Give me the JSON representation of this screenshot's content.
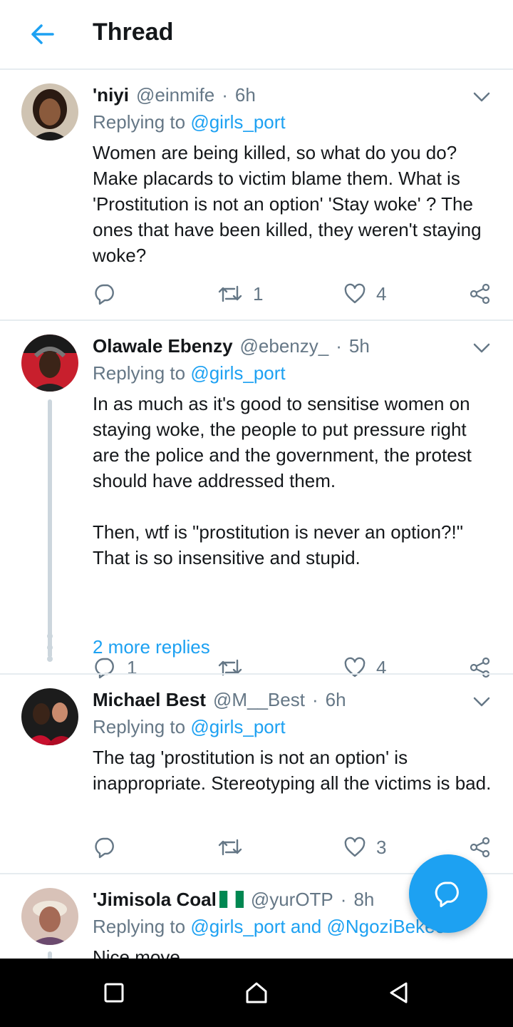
{
  "header": {
    "title": "Thread"
  },
  "tweets": [
    {
      "name": "'niyi",
      "handle": "@einmife",
      "dot": "·",
      "time": "6h",
      "reply_prefix": "Replying to",
      "reply_to": "@girls_port",
      "text": "Women are being killed, so what do you do? Make placards to victim blame them. What is 'Prostitution is not an option' 'Stay woke' ? The ones that have been killed, they weren't staying woke?",
      "retweets": "1",
      "likes": "4"
    },
    {
      "name": "Olawale Ebenzy",
      "handle": "@ebenzy_",
      "dot": "·",
      "time": "5h",
      "reply_prefix": "Replying to",
      "reply_to": "@girls_port",
      "text": "In as much as it's good to sensitise women on staying woke, the people to put pressure right are the police and the government, the protest should have addressed them.\n\nThen, wtf is \"prostitution is never an option?!\" That is so insensitive and stupid.",
      "replies": "1",
      "likes": "4",
      "more_replies": "2 more replies"
    },
    {
      "name": "Michael Best",
      "handle": "@M__Best",
      "dot": "·",
      "time": "6h",
      "reply_prefix": "Replying to",
      "reply_to": "@girls_port",
      "text": "The tag 'prostitution is not an option' is inappropriate. Stereotyping all the victims is bad.",
      "likes": "3"
    },
    {
      "name": "'Jimisola Coal",
      "handle": "@yurOTP",
      "dot": "·",
      "time": "8h",
      "reply_prefix": "Replying to",
      "reply_to": "@girls_port and @NgoziBekee",
      "text": "Nice move"
    }
  ],
  "icons": {
    "back": "arrow-left-icon",
    "caret": "chevron-down-icon",
    "reply": "reply-bubble-icon",
    "retweet": "retweet-icon",
    "like": "heart-icon",
    "share": "share-icon",
    "compose": "compose-reply-icon",
    "flag": "nigeria-flag-emoji"
  },
  "colors": {
    "accent": "#1da1f2",
    "secondary_text": "#657786",
    "primary_text": "#14171a",
    "divider": "#e6ecf0",
    "thread_line": "#ccd6dd",
    "navbar": "#000000"
  }
}
